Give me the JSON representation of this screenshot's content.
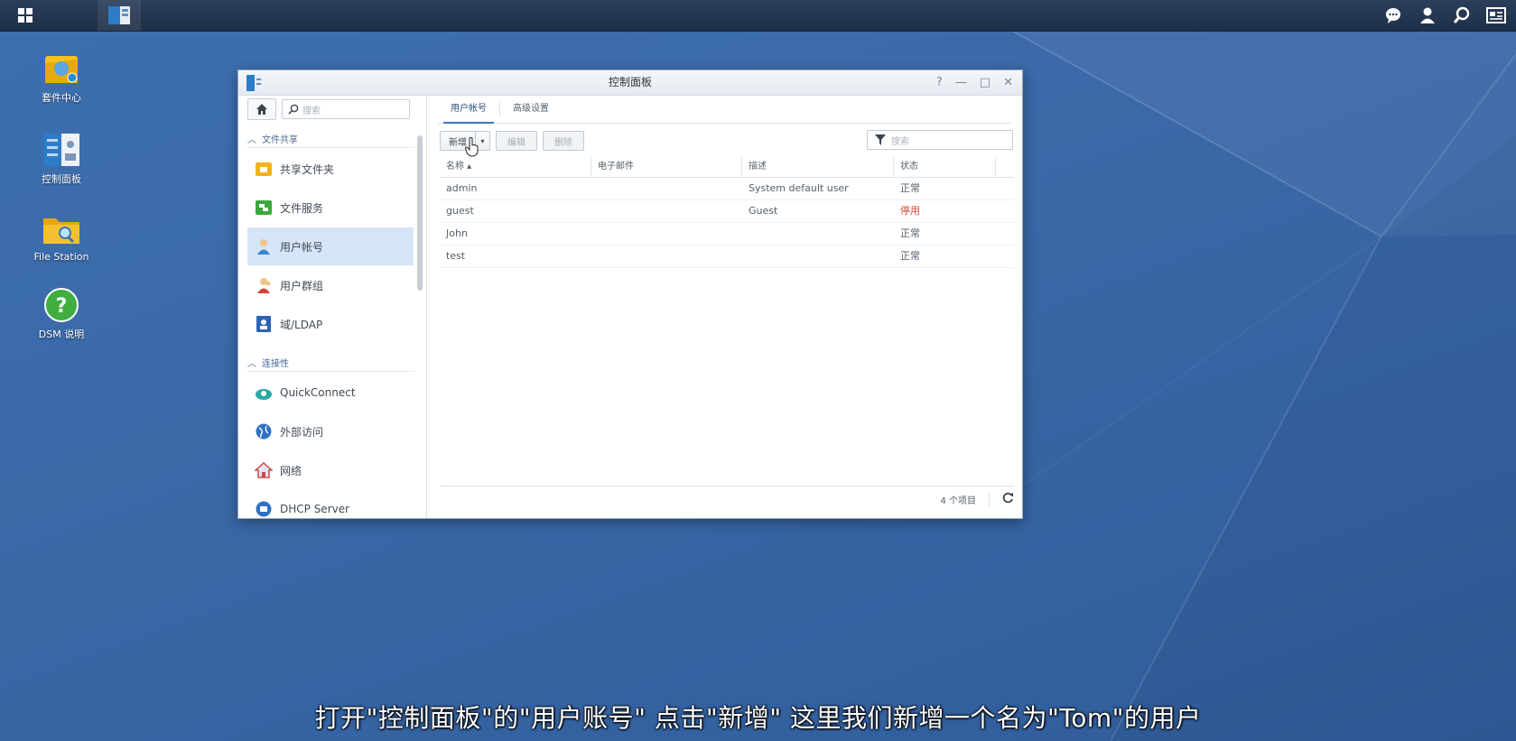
{
  "desktop": {
    "icons": [
      {
        "label": "套件中心"
      },
      {
        "label": "控制面板"
      },
      {
        "label": "File Station"
      },
      {
        "label": "DSM 说明"
      }
    ]
  },
  "taskbar": {
    "right_icons": [
      "chat-icon",
      "user-icon",
      "search-icon",
      "widgets-icon"
    ]
  },
  "window": {
    "title": "控制面板",
    "controls": {
      "help": "?",
      "minimize": "—",
      "maximize": "□",
      "close": "✕"
    }
  },
  "sidebar": {
    "search_placeholder": "搜索",
    "sections": [
      {
        "label": "文件共享"
      },
      {
        "label": "连接性"
      }
    ],
    "items": [
      {
        "label": "共享文件夹"
      },
      {
        "label": "文件服务"
      },
      {
        "label": "用户帐号"
      },
      {
        "label": "用户群组"
      },
      {
        "label": "域/LDAP"
      },
      {
        "label": "QuickConnect"
      },
      {
        "label": "外部访问"
      },
      {
        "label": "网络"
      },
      {
        "label": "DHCP Server"
      }
    ]
  },
  "main": {
    "tabs": [
      {
        "label": "用户帐号"
      },
      {
        "label": "高级设置"
      }
    ],
    "toolbar": {
      "create_label": "新增",
      "edit_label": "编辑",
      "delete_label": "删除"
    },
    "filter_placeholder": "搜索",
    "columns": [
      "名称 ▴",
      "电子邮件",
      "描述",
      "状态"
    ],
    "rows": [
      {
        "name": "admin",
        "email": "",
        "description": "System default user",
        "status": "正常"
      },
      {
        "name": "guest",
        "email": "",
        "description": "Guest",
        "status": "停用"
      },
      {
        "name": "John",
        "email": "",
        "description": "",
        "status": "正常"
      },
      {
        "name": "test",
        "email": "",
        "description": "",
        "status": "正常"
      }
    ],
    "footer_count": "4 个项目"
  },
  "subtitle": "打开\"控制面板\"的\"用户账号\" 点击\"新增\" 这里我们新增一个名为\"Tom\"的用户",
  "colors": {
    "accent": "#3b79c4",
    "disabled_status": "#d24a3a",
    "desktop": "#3a69a8"
  }
}
